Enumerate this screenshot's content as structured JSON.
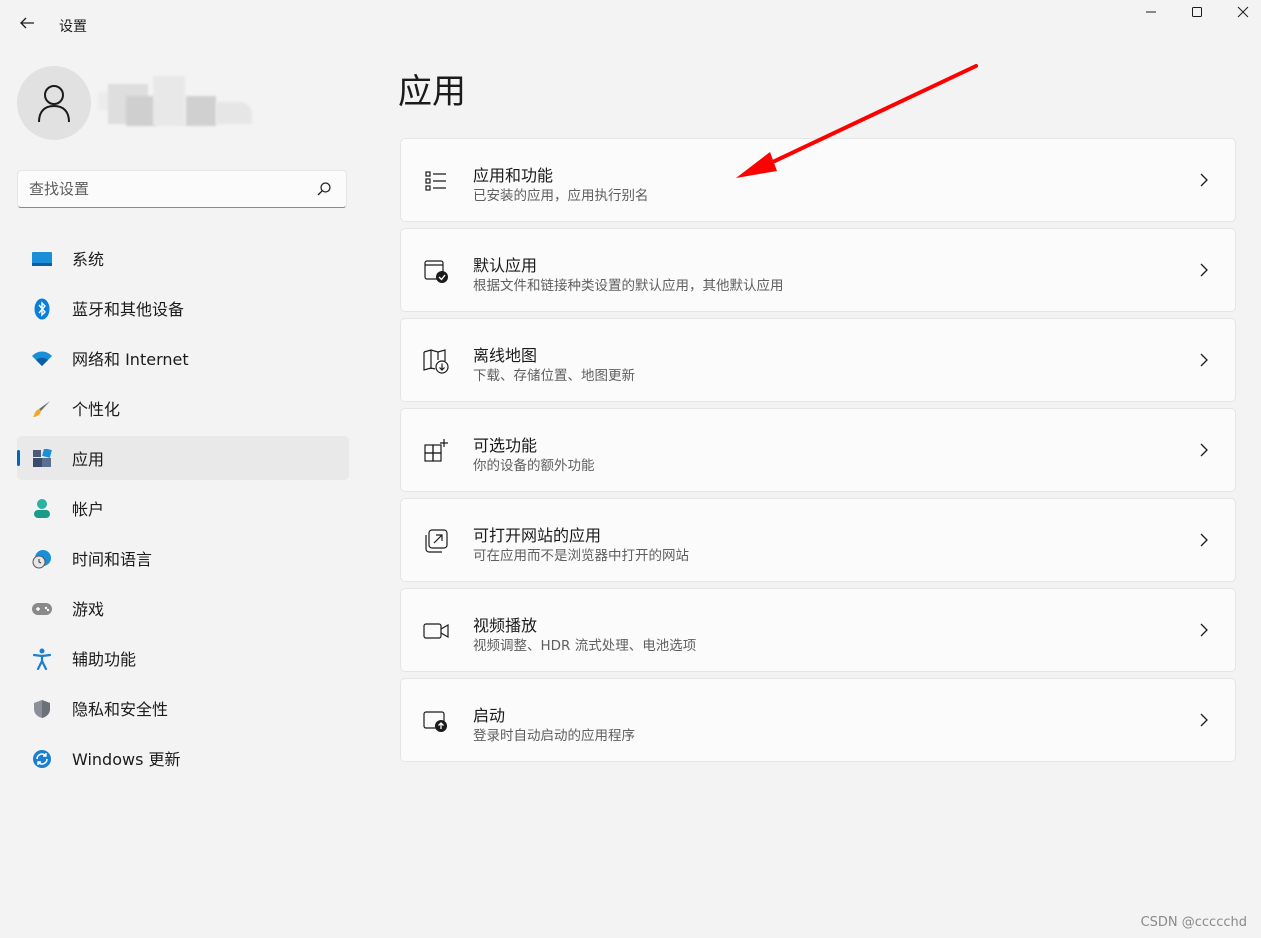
{
  "window": {
    "title": "设置",
    "back_icon": "back-arrow-icon",
    "minimize_icon": "minimize-icon",
    "maximize_icon": "maximize-icon",
    "close_icon": "close-icon"
  },
  "user": {
    "avatar_icon": "user-avatar-icon",
    "name_obscured": true
  },
  "search": {
    "placeholder": "查找设置",
    "value": "",
    "icon": "search-icon"
  },
  "sidebar": {
    "accent_color": "#0067c0",
    "active_index": 4,
    "items": [
      {
        "label": "系统",
        "icon": "system-display-icon"
      },
      {
        "label": "蓝牙和其他设备",
        "icon": "bluetooth-icon"
      },
      {
        "label": "网络和 Internet",
        "icon": "wifi-icon"
      },
      {
        "label": "个性化",
        "icon": "paintbrush-icon"
      },
      {
        "label": "应用",
        "icon": "apps-icon"
      },
      {
        "label": "帐户",
        "icon": "account-person-icon"
      },
      {
        "label": "时间和语言",
        "icon": "globe-clock-icon"
      },
      {
        "label": "游戏",
        "icon": "gamepad-icon"
      },
      {
        "label": "辅助功能",
        "icon": "accessibility-icon"
      },
      {
        "label": "隐私和安全性",
        "icon": "shield-icon"
      },
      {
        "label": "Windows 更新",
        "icon": "windows-update-icon"
      }
    ]
  },
  "main": {
    "title": "应用",
    "cards": [
      {
        "title": "应用和功能",
        "subtitle": "已安装的应用，应用执行别名",
        "icon": "list-icon"
      },
      {
        "title": "默认应用",
        "subtitle": "根据文件和链接种类设置的默认应用，其他默认应用",
        "icon": "default-app-check-icon"
      },
      {
        "title": "离线地图",
        "subtitle": "下载、存储位置、地图更新",
        "icon": "map-download-icon"
      },
      {
        "title": "可选功能",
        "subtitle": "你的设备的额外功能",
        "icon": "add-feature-icon"
      },
      {
        "title": "可打开网站的应用",
        "subtitle": "可在应用而不是浏览器中打开的网站",
        "icon": "open-external-icon"
      },
      {
        "title": "视频播放",
        "subtitle": "视频调整、HDR 流式处理、电池选项",
        "icon": "video-camera-icon"
      },
      {
        "title": "启动",
        "subtitle": "登录时自动启动的应用程序",
        "icon": "startup-icon"
      }
    ],
    "chevron_icon": "chevron-right-icon"
  },
  "annotation": {
    "type": "arrow",
    "color": "#ff0000",
    "points_to": "应用和功能"
  },
  "watermark": "CSDN @ccccchd"
}
